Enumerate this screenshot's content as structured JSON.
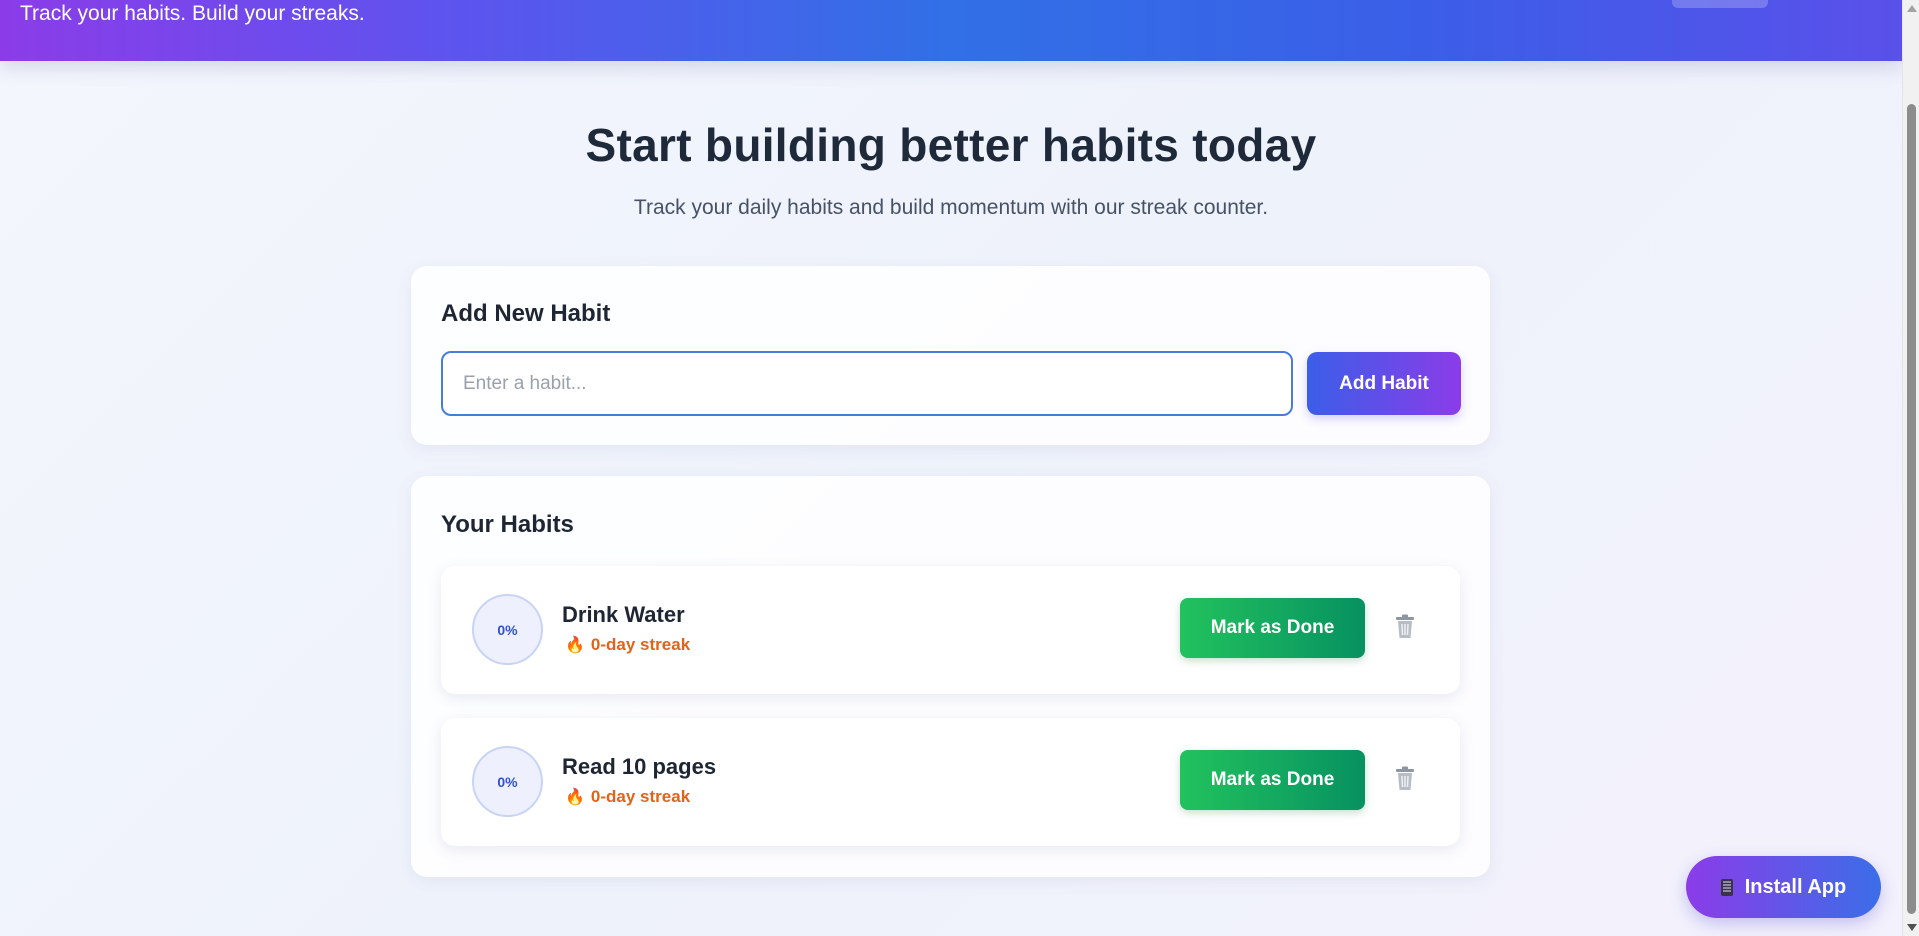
{
  "header": {
    "tagline": "Track your habits. Build your streaks."
  },
  "hero": {
    "title": "Start building better habits today",
    "subtitle": "Track your daily habits and build momentum with our streak counter."
  },
  "add_habit": {
    "title": "Add New Habit",
    "input_placeholder": "Enter a habit...",
    "input_value": "",
    "button_label": "Add Habit"
  },
  "habits": {
    "title": "Your Habits",
    "items": [
      {
        "progress": "0%",
        "name": "Drink Water",
        "streak": "0-day streak",
        "done_label": "Mark as Done"
      },
      {
        "progress": "0%",
        "name": "Read 10 pages",
        "streak": "0-day streak",
        "done_label": "Mark as Done"
      }
    ]
  },
  "install": {
    "label": "Install App"
  },
  "icons": {
    "streak": "fire-icon",
    "delete": "trash-icon",
    "install": "phone-icon"
  },
  "colors": {
    "header_gradient": [
      "#8b3ce8",
      "#3170e6"
    ],
    "primary_button": [
      "#3b5ee8",
      "#8b3ce8"
    ],
    "done_button": [
      "#22c25e",
      "#079161"
    ],
    "streak_text": "#e0641b",
    "progress_text": "#2f55c4"
  }
}
